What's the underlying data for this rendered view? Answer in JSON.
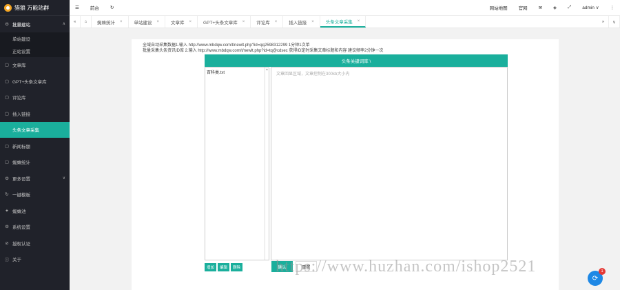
{
  "brand": {
    "name": "猎狼 万能站群"
  },
  "sidebar": {
    "items": [
      {
        "label": "批量建站",
        "icon": "gear-icon",
        "glyph": "⚙",
        "chevron": "∧"
      },
      {
        "label": "单站建设"
      },
      {
        "label": "正站设置"
      },
      {
        "label": "文章库",
        "icon": "document-icon",
        "glyph": "▢"
      },
      {
        "label": "GPT+头条文章库",
        "icon": "document-icon",
        "glyph": "▢"
      },
      {
        "label": "评论库",
        "icon": "document-icon",
        "glyph": "▢"
      },
      {
        "label": "插入链接",
        "icon": "document-icon",
        "glyph": "▢"
      },
      {
        "label": "头条文章采集"
      },
      {
        "label": "新闻标题",
        "icon": "document-icon",
        "glyph": "▢"
      },
      {
        "label": "蜘蛛统计",
        "icon": "document-icon",
        "glyph": "▢"
      },
      {
        "label": "更多设置",
        "icon": "gear-icon",
        "glyph": "⚙",
        "chevron": "∨"
      },
      {
        "label": "一键模板",
        "icon": "refresh-icon",
        "glyph": "↻"
      },
      {
        "label": "蜘蛛池",
        "icon": "spider-icon",
        "glyph": "✦"
      },
      {
        "label": "系统设置",
        "icon": "gear-icon",
        "glyph": "⚙"
      },
      {
        "label": "授权认证",
        "icon": "shield-icon",
        "glyph": "⊘"
      },
      {
        "label": "关于",
        "icon": "info-icon",
        "glyph": "ⓘ"
      }
    ]
  },
  "topbar": {
    "menu_glyph": "☰",
    "home": "前台",
    "refresh_glyph": "↻",
    "site_map": "网站地图",
    "official": "官网",
    "msg_glyph": "✉",
    "tag_glyph": "◈",
    "full_glyph": "⤢",
    "user": "admin ∨",
    "more_glyph": "⋮"
  },
  "tabs": {
    "prev_glyph": "«",
    "home_glyph": "⌂",
    "next_glyph": "»",
    "down_glyph": "∨",
    "close_glyph": "×",
    "items": [
      {
        "label": "蜘蛛统计"
      },
      {
        "label": "单站建设"
      },
      {
        "label": "文章库"
      },
      {
        "label": "GPT+头条文章库"
      },
      {
        "label": "评论库"
      },
      {
        "label": "插入链接"
      },
      {
        "label": "头条文章采集"
      }
    ]
  },
  "main": {
    "info_line1": "全域自动采集数据1.输入 http://www.mbdqw.com/t/newlt.php?id=qq2598312299 1分钟1次单",
    "info_line2": "批量采集头条资讯ID库 2.输入 http://www.mbdqw.com/t/newlt.php?id=tq@cdsec 获得ID定时采集文章标题和内容 建议频率2分钟一次",
    "header": "头条关键词库 \\",
    "file": "百科类.txt",
    "placeholder": "文章回显区域，文章控制在300kb大小内",
    "btn_add": "增加",
    "btn_edit": "编辑",
    "btn_delete": "删除",
    "btn_confirm": "确认",
    "btn_reset": "重置"
  },
  "watermark": "https://www.huzhan.com/ishop2521",
  "float": {
    "glyph": "⟳",
    "badge": "1"
  }
}
